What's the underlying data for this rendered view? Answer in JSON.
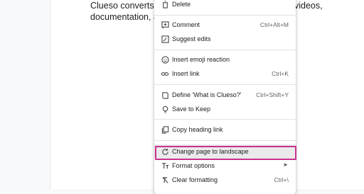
{
  "document": {
    "line1_left": "Clueso converts roug",
    "line1_right": "videos,",
    "line2_left": "documentation, and"
  },
  "menu": {
    "delete": {
      "label": "Delete",
      "icon": "trash-icon"
    },
    "comment": {
      "label": "Comment",
      "shortcut": "Ctrl+Alt+M",
      "icon": "add-comment-icon"
    },
    "suggest": {
      "label": "Suggest edits",
      "icon": "suggest-edit-icon"
    },
    "emoji": {
      "label": "Insert emoji reaction",
      "icon": "emoji-icon"
    },
    "link": {
      "label": "Insert link",
      "shortcut": "Ctrl+K",
      "icon": "link-icon"
    },
    "define": {
      "label": "Define 'What is Clueso?'",
      "shortcut": "Ctrl+Shift+Y",
      "icon": "book-icon"
    },
    "keep": {
      "label": "Save to Keep",
      "icon": "lightbulb-icon"
    },
    "copy_heading": {
      "label": "Copy heading link",
      "icon": "copy-icon"
    },
    "landscape": {
      "label": "Change page to landscape",
      "icon": "rotate-icon"
    },
    "format": {
      "label": "Format options",
      "icon": "text-format-icon"
    },
    "clear": {
      "label": "Clear formatting",
      "shortcut": "Ctrl+\\",
      "icon": "clear-format-icon"
    }
  },
  "colors": {
    "highlight_border": "#c9328f",
    "hover_bg": "#eaeaea"
  }
}
